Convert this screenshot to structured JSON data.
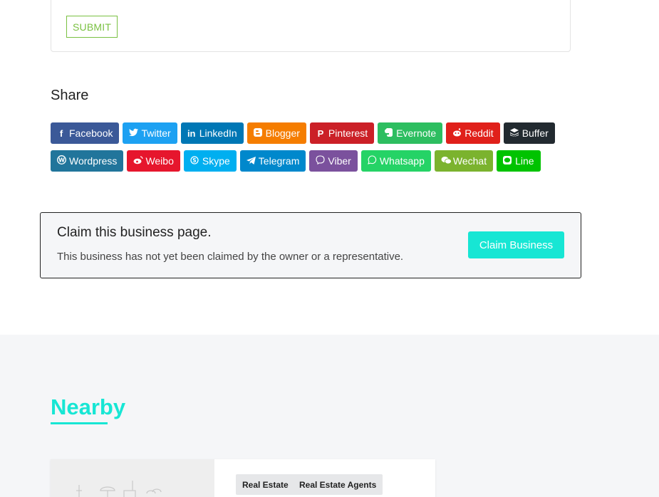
{
  "review_form": {
    "submit_label": "SUBMIT"
  },
  "share": {
    "title": "Share",
    "row1": [
      {
        "label": "Facebook",
        "icon": "facebook-icon",
        "color": "#3b5998"
      },
      {
        "label": "Twitter",
        "icon": "twitter-icon",
        "color": "#1da1f2"
      },
      {
        "label": "LinkedIn",
        "icon": "linkedin-icon",
        "color": "#0077b5"
      },
      {
        "label": "Blogger",
        "icon": "blogger-icon",
        "color": "#f57d00"
      },
      {
        "label": "Pinterest",
        "icon": "pinterest-icon",
        "color": "#cb2027"
      },
      {
        "label": "Evernote",
        "icon": "evernote-icon",
        "color": "#2dbe60"
      },
      {
        "label": "Reddit",
        "icon": "reddit-icon",
        "color": "#e0201a"
      },
      {
        "label": "Buffer",
        "icon": "buffer-icon",
        "color": "#222a30"
      }
    ],
    "row2": [
      {
        "label": "Wordpress",
        "icon": "wordpress-icon",
        "color": "#21759b"
      },
      {
        "label": "Weibo",
        "icon": "weibo-icon",
        "color": "#e6162d"
      },
      {
        "label": "Skype",
        "icon": "skype-icon",
        "color": "#00aff0"
      },
      {
        "label": "Telegram",
        "icon": "telegram-icon",
        "color": "#0088cc"
      },
      {
        "label": "Viber",
        "icon": "viber-icon",
        "color": "#7b519d"
      },
      {
        "label": "Whatsapp",
        "icon": "whatsapp-icon",
        "color": "#25d366"
      },
      {
        "label": "Wechat",
        "icon": "wechat-icon",
        "color": "#7bb32e"
      },
      {
        "label": "Line",
        "icon": "line-icon",
        "color": "#00c300"
      }
    ]
  },
  "claim": {
    "title": "Claim this business page.",
    "description": "This business has not yet been claimed by the owner or a representative.",
    "button_label": "Claim Business"
  },
  "nearby": {
    "title": "Nearby",
    "listing": {
      "tags": [
        "Real Estate",
        "Real Estate Agents"
      ]
    }
  },
  "colors": {
    "accent": "#17e6d4",
    "submit": "#7ac142"
  }
}
